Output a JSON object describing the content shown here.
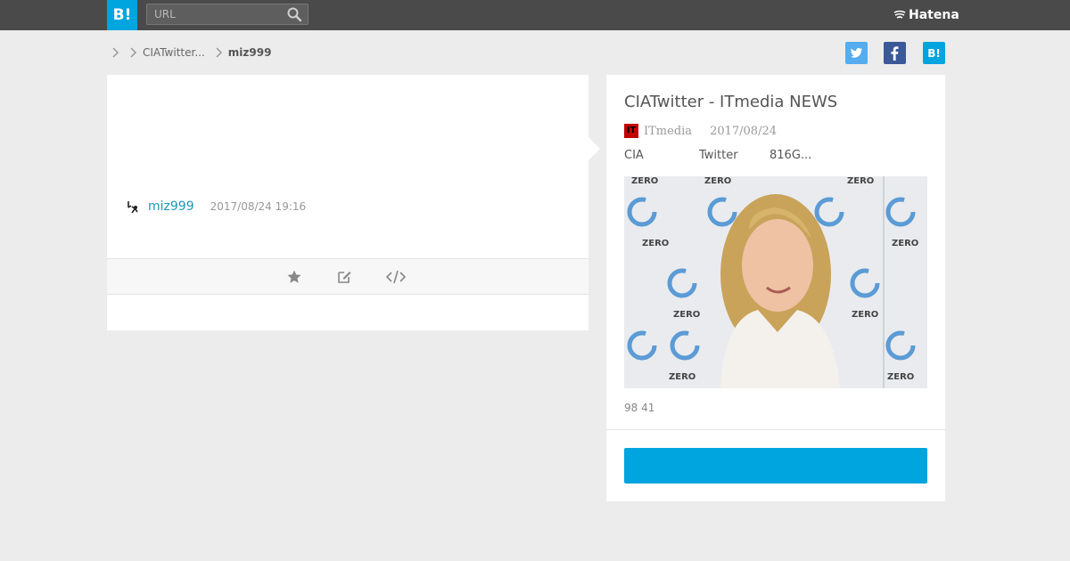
{
  "header": {
    "logo_text": "B!",
    "search_placeholder": "URL",
    "hatena_label": "Hatena",
    "search_icon": "search-icon"
  },
  "breadcrumb": {
    "items": [
      "",
      "CIATwitter...",
      "miz999"
    ]
  },
  "share": {
    "twitter_icon": "twitter-icon",
    "facebook_icon": "facebook-icon",
    "hatena_icon": "hatena-bookmark-icon",
    "colors": {
      "twitter": "#55acee",
      "facebook": "#3b5998",
      "hatena": "#00a4de"
    }
  },
  "bookmark": {
    "username": "miz999",
    "timestamp": "2017/08/24 19:16",
    "actions": [
      "star-icon",
      "edit-icon",
      "embed-code-icon"
    ]
  },
  "entry": {
    "title": "CIATwitter - ITmedia NEWS",
    "site_name": "ITmedia",
    "favicon_text": "IT",
    "date": "2017/08/24",
    "tags": [
      "CIA",
      "Twitter",
      "816G..."
    ],
    "counts": "98 41",
    "bookmark_button_label": ""
  },
  "colors": {
    "accent": "#00a4de",
    "link": "#1b97b6",
    "topbar": "#4a4a4a",
    "background": "#ececec"
  }
}
